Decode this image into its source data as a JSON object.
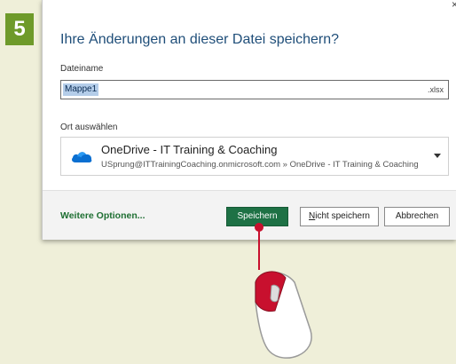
{
  "step_badge": "5",
  "dialog": {
    "close_glyph": "×",
    "title": "Ihre Änderungen an dieser Datei speichern?",
    "filename_label": "Dateiname",
    "filename_value": "Mappe1",
    "filename_extension": ".xlsx",
    "location_label": "Ort auswählen",
    "location": {
      "name": "OneDrive - IT Training & Coaching",
      "path": "USprung@ITTrainingCoaching.onmicrosoft.com » OneDrive - IT Training & Coaching",
      "icon": "onedrive-cloud-icon"
    },
    "more_options": "Weitere Optionen...",
    "buttons": {
      "save": "Speichern",
      "dont_save_accel": "N",
      "dont_save_rest": "icht speichern",
      "cancel": "Abbrechen"
    }
  },
  "colors": {
    "badge": "#6e9a2a",
    "save_button": "#1e7145",
    "title": "#1f4e79",
    "pointer": "#c8102e",
    "onedrive": "#0a6fd1"
  }
}
